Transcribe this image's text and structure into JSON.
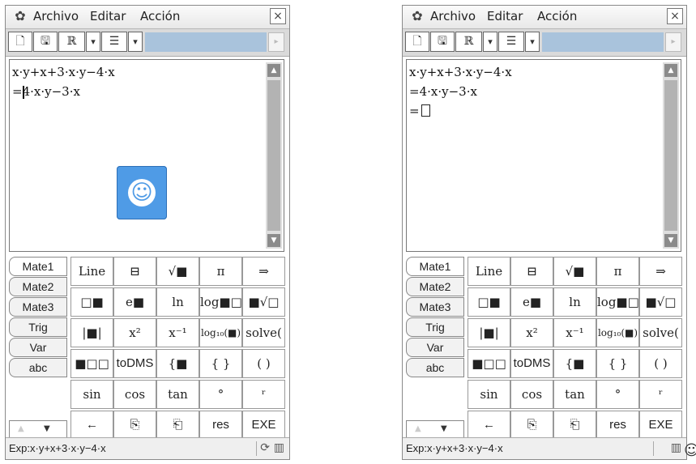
{
  "menu": {
    "items": [
      "Archivo",
      "Editar",
      "Acción"
    ],
    "close": "×"
  },
  "toolbar": {
    "new": "🗋",
    "save": "🖫",
    "reals": "ℝ",
    "dd1": "▾",
    "list": "☰",
    "dd2": "▾",
    "right_arrow": "▸"
  },
  "left": {
    "lines": [
      "x·y+x+3·x·y−4·x",
      "=4·x·y−3·x"
    ],
    "status": "Exp:x·y+x+3·x·y−4·x",
    "smiley": "☺"
  },
  "right": {
    "lines": [
      "x·y+x+3·x·y−4·x",
      "=4·x·y−3·x",
      "="
    ],
    "status": "Exp:x·y+x+3·x·y−4·x"
  },
  "side_tabs": [
    "Mate1",
    "Mate2",
    "Mate3",
    "Trig",
    "Var",
    "abc"
  ],
  "keys": [
    [
      "Line",
      "⊟",
      "√■",
      "π",
      "⇒"
    ],
    [
      "□■",
      "e■",
      "ln",
      "log■□",
      "■√□"
    ],
    [
      "|■|",
      "x²",
      "x⁻¹",
      "log₁₀(■)",
      "solve("
    ],
    [
      "■□□",
      "toDMS",
      "{■",
      "{ }",
      "( )"
    ],
    [
      "sin",
      "cos",
      "tan",
      "°",
      "ʳ"
    ],
    [
      "←",
      "⎘",
      "⎗",
      "res",
      "EXE"
    ]
  ],
  "scroll": {
    "up": "▲",
    "down": "▼"
  },
  "status_icons": {
    "refresh": "⟳",
    "battery": "▥"
  },
  "trailing_smiley": "☺"
}
